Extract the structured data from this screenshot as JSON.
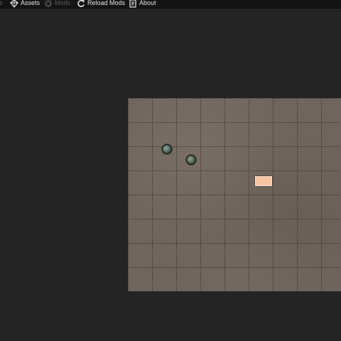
{
  "menubar": {
    "clipped_label": "o",
    "items": [
      {
        "label": "Assets",
        "icon": "assets-gem-icon",
        "enabled": true
      },
      {
        "label": "Mods",
        "icon": "mods-gear-icon",
        "enabled": false
      },
      {
        "label": "Reload Mods",
        "icon": "reload-icon",
        "enabled": true
      },
      {
        "label": "About",
        "icon": "about-document-icon",
        "enabled": true
      }
    ]
  },
  "map": {
    "grid_columns": 9,
    "grid_rows": 8,
    "tokens": [
      {
        "name": "token-1"
      },
      {
        "name": "token-2"
      }
    ],
    "marker": {
      "color": "#f6c6a3"
    }
  },
  "colors": {
    "background": "#242424",
    "menubar": "#141414",
    "board": "#6f655d",
    "grid_line": "#2a2622"
  }
}
